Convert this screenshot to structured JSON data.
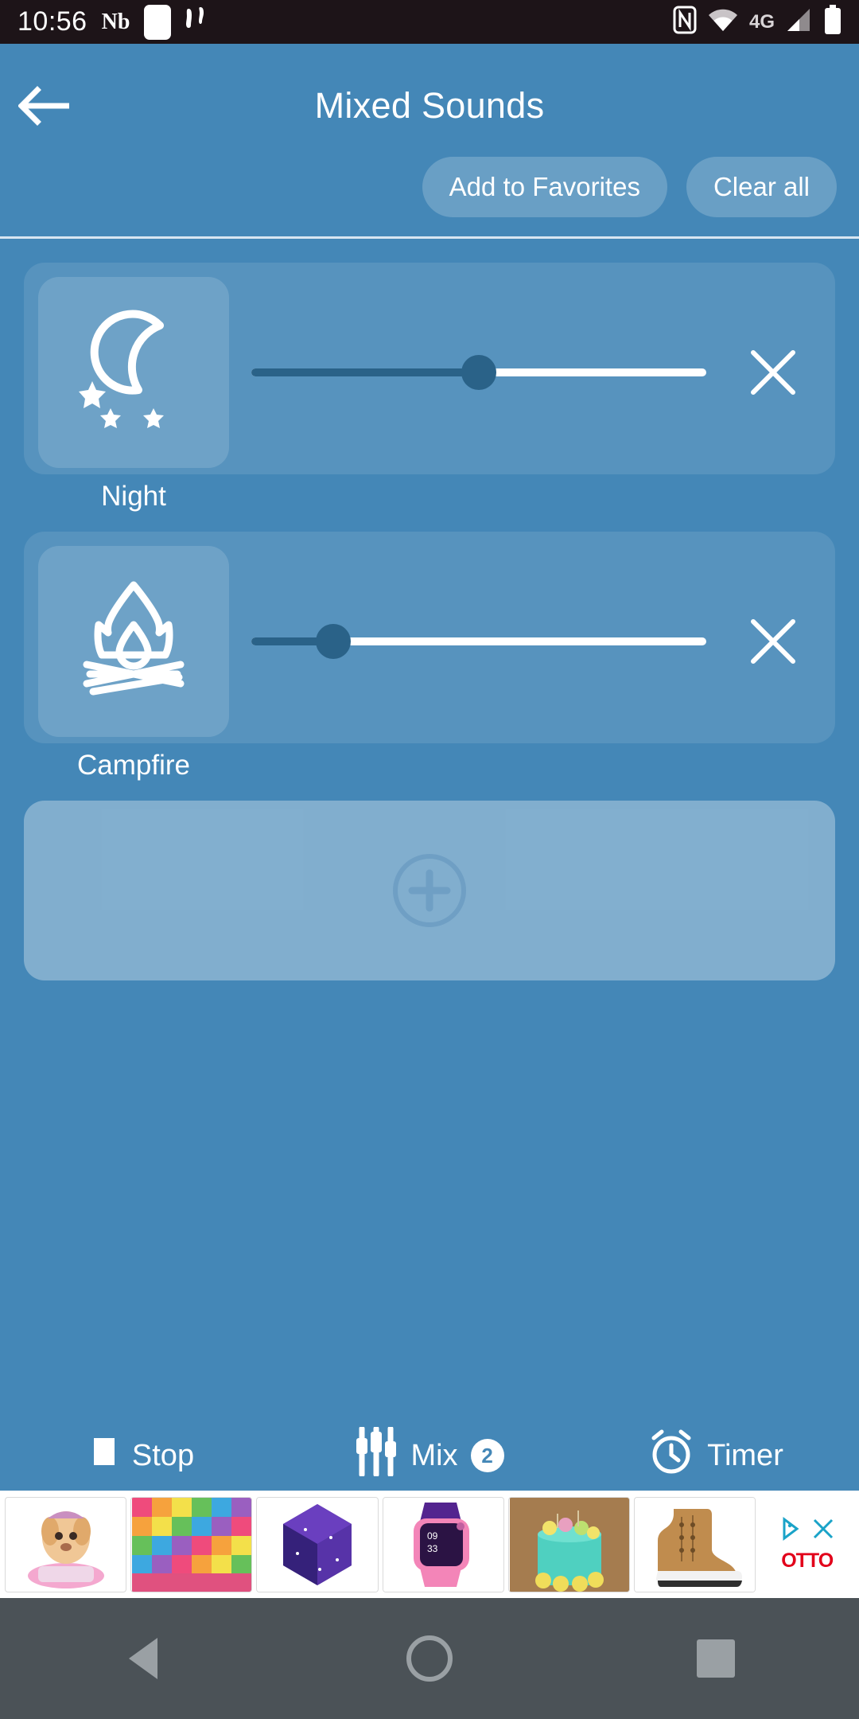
{
  "statusbar": {
    "time": "10:56",
    "nb_label": "Nb",
    "network": "4G",
    "icons": [
      "notes-icon",
      "footsteps-icon",
      "nfc-icon",
      "wifi-icon",
      "signal-icon",
      "battery-icon"
    ]
  },
  "header": {
    "title": "Mixed Sounds",
    "back_icon": "arrow-left-icon",
    "add_favorites_label": "Add to Favorites",
    "clear_all_label": "Clear all"
  },
  "sounds": [
    {
      "name": "Night",
      "icon": "moon-stars-icon",
      "volume": 50,
      "remove_icon": "close-icon"
    },
    {
      "name": "Campfire",
      "icon": "campfire-icon",
      "volume": 18,
      "remove_icon": "close-icon"
    }
  ],
  "add_card": {
    "icon": "plus-circle-icon",
    "label": ""
  },
  "bottombar": {
    "stop_label": "Stop",
    "stop_icon": "stop-square-icon",
    "mix_label": "Mix",
    "mix_icon": "equalizer-icon",
    "mix_count": "2",
    "timer_label": "Timer",
    "timer_icon": "alarm-clock-icon"
  },
  "ad": {
    "brand": "OTTO",
    "adchoices_icon": "adchoices-icon",
    "close_icon": "close-icon",
    "items": [
      {
        "name": "paw-patrol-toy"
      },
      {
        "name": "rainbow-blocks"
      },
      {
        "name": "galaxy-cube"
      },
      {
        "name": "pink-kids-smartwatch"
      },
      {
        "name": "turquoise-cake"
      },
      {
        "name": "tan-boot"
      }
    ]
  },
  "navbar": {
    "back_icon": "nav-back-icon",
    "home_icon": "nav-home-icon",
    "recents_icon": "nav-recents-icon"
  },
  "colors": {
    "app_bg": "#4487b7",
    "statusbar_bg": "#1d1418",
    "slider_fill": "#2a6288",
    "slider_track": "#ffffff",
    "navbar_bg": "#4b5257"
  }
}
